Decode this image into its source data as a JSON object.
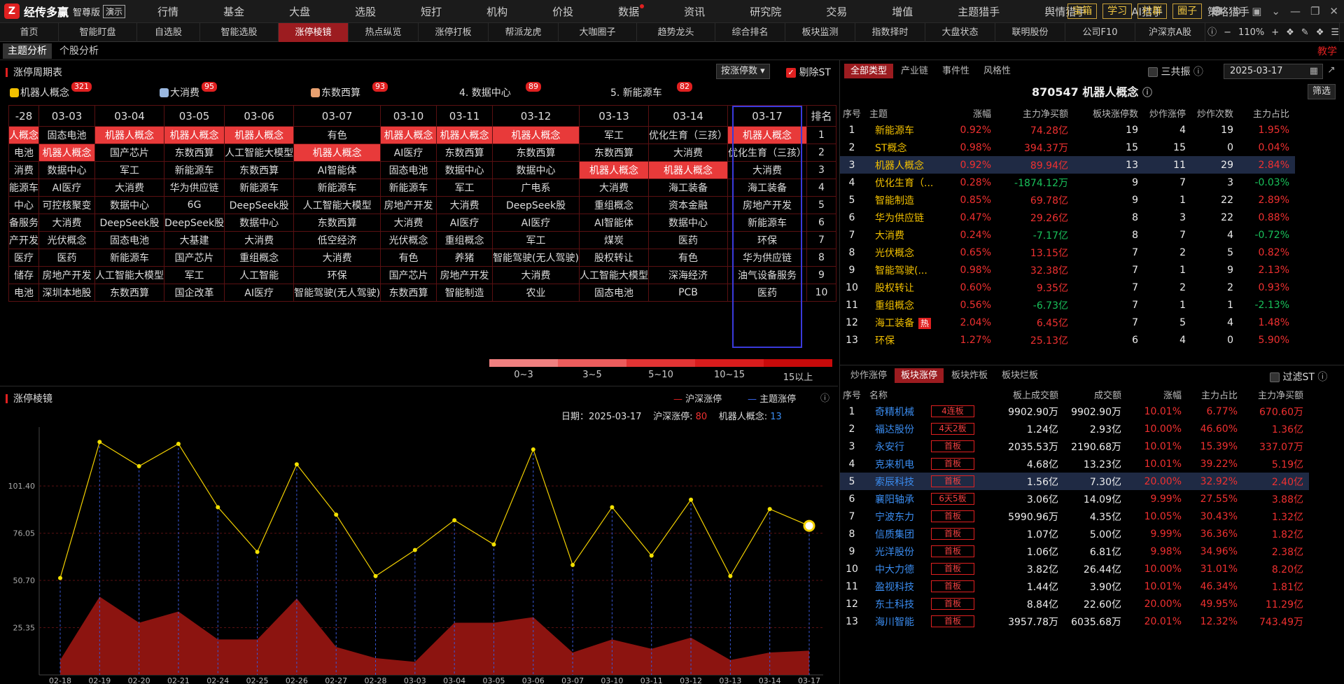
{
  "app": {
    "logo": "经传多赢",
    "edition": "智尊版",
    "demo": "演示"
  },
  "main_nav": [
    "行情",
    "基金",
    "大盘",
    "选股",
    "短打",
    "机构",
    "价投",
    "数据",
    "资讯",
    "研究院",
    "交易",
    "增值",
    "主题猎手",
    "舆情猎手",
    "AI猎手",
    "策略猎手"
  ],
  "top_right": {
    "buttons": [
      "宝箱",
      "学习",
      "社群",
      "圈子"
    ]
  },
  "sub_nav": [
    "首页",
    "智能盯盘",
    "自选股",
    "智能选股",
    "涨停棱镜",
    "热点纵览",
    "涨停打板",
    "帮派龙虎",
    "大咖圈子",
    "趋势龙头",
    "综合排名",
    "板块监测",
    "指数择时",
    "大盘状态",
    "联明股份",
    "公司F10",
    "沪深京A股"
  ],
  "sub_nav_active": "涨停棱镜",
  "zoom": "110%",
  "row3": {
    "tabs": [
      "主题分析",
      "个股分析"
    ],
    "teach": "教学"
  },
  "cycle": {
    "title": "涨停周期表",
    "sort_btn": "按涨停数",
    "exclude_st": "剔除ST",
    "top_themes": [
      {
        "name": "机器人概念",
        "badge": "321",
        "icon": "#f2c000"
      },
      {
        "name": "大消费",
        "badge": "95",
        "icon": "#9ab8e0"
      },
      {
        "name": "东数西算",
        "badge": "93",
        "icon": "#e8a070"
      },
      {
        "name": "4. 数据中心",
        "badge": "89"
      },
      {
        "name": "5. 新能源车",
        "badge": "82"
      }
    ],
    "dates": [
      "-28",
      "03-03",
      "03-04",
      "03-05",
      "03-06",
      "03-07",
      "03-10",
      "03-11",
      "03-12",
      "03-13",
      "03-14",
      "03-17"
    ],
    "rank_header": "排名",
    "rows": [
      [
        "人概念",
        "固态电池",
        "机器人概念",
        "机器人概念",
        "机器人概念",
        "有色",
        "机器人概念",
        "机器人概念",
        "机器人概念",
        "军工",
        "优化生育（三孩）",
        "机器人概念"
      ],
      [
        "电池",
        "机器人概念",
        "国产芯片",
        "东数西算",
        "人工智能大模型",
        "机器人概念",
        "AI医疗",
        "东数西算",
        "东数西算",
        "东数西算",
        "大消费",
        "优化生育（三孩）"
      ],
      [
        "消费",
        "数据中心",
        "军工",
        "新能源车",
        "东数西算",
        "AI智能体",
        "固态电池",
        "数据中心",
        "数据中心",
        "机器人概念",
        "机器人概念",
        "大消费"
      ],
      [
        "能源车",
        "AI医疗",
        "大消费",
        "华为供应链",
        "新能源车",
        "新能源车",
        "新能源车",
        "军工",
        "广电系",
        "大消费",
        "海工装备",
        "海工装备"
      ],
      [
        "中心",
        "可控核聚变",
        "数据中心",
        "6G",
        "DeepSeek股",
        "人工智能大模型",
        "房地产开发",
        "大消费",
        "DeepSeek股",
        "重组概念",
        "资本金融",
        "房地产开发"
      ],
      [
        "备服务",
        "大消费",
        "DeepSeek股",
        "DeepSeek股",
        "数据中心",
        "东数西算",
        "大消费",
        "AI医疗",
        "AI医疗",
        "AI智能体",
        "数据中心",
        "新能源车"
      ],
      [
        "产开发",
        "光伏概念",
        "固态电池",
        "大基建",
        "大消费",
        "低空经济",
        "光伏概念",
        "重组概念",
        "军工",
        "煤炭",
        "医药",
        "环保"
      ],
      [
        "医疗",
        "医药",
        "新能源车",
        "国产芯片",
        "重组概念",
        "大消费",
        "有色",
        "养猪",
        "智能驾驶(无人驾驶)",
        "股权转让",
        "有色",
        "华为供应链"
      ],
      [
        "储存",
        "房地产开发",
        "人工智能大模型",
        "军工",
        "人工智能",
        "环保",
        "国产芯片",
        "房地产开发",
        "大消费",
        "人工智能大模型",
        "深海经济",
        "油气设备服务"
      ],
      [
        "电池",
        "深圳本地股",
        "东数西算",
        "国企改革",
        "AI医疗",
        "智能驾驶(无人驾驶)",
        "东数西算",
        "智能制造",
        "农业",
        "固态电池",
        "PCB",
        "医药"
      ]
    ],
    "red_cells": [
      [
        0,
        0
      ],
      [
        0,
        2
      ],
      [
        0,
        3
      ],
      [
        0,
        4
      ],
      [
        0,
        6
      ],
      [
        0,
        7
      ],
      [
        0,
        8
      ],
      [
        0,
        11
      ],
      [
        1,
        1
      ],
      [
        1,
        5
      ],
      [
        2,
        9
      ],
      [
        2,
        10
      ]
    ],
    "ranks": [
      "1",
      "2",
      "3",
      "4",
      "5",
      "6",
      "7",
      "8",
      "9",
      "10"
    ],
    "legend": [
      {
        "label": "0~3",
        "color": "#f08080"
      },
      {
        "label": "3~5",
        "color": "#ec5c5c"
      },
      {
        "label": "5~10",
        "color": "#e23434"
      },
      {
        "label": "10~15",
        "color": "#d81c1c"
      },
      {
        "label": "15以上",
        "color": "#c80a0a"
      }
    ]
  },
  "prism": {
    "title": "涨停棱镜",
    "legend_a": "沪深涨停",
    "legend_b": "主题涨停",
    "info": {
      "date_label": "日期：",
      "date": "2025-03-17",
      "hs_label": "沪深涨停:",
      "hs_value": "80",
      "theme_label": "机器人概念:",
      "theme_value": "13"
    }
  },
  "chart_data": {
    "type": "line",
    "categories": [
      "02-18",
      "02-19",
      "02-20",
      "02-21",
      "02-24",
      "02-25",
      "02-26",
      "02-27",
      "02-28",
      "03-03",
      "03-04",
      "03-05",
      "03-06",
      "03-07",
      "03-10",
      "03-11",
      "03-12",
      "03-13",
      "03-14",
      "03-17"
    ],
    "series": [
      {
        "name": "沪深涨停",
        "values": [
          52,
          125,
          112,
          124,
          90,
          66,
          113,
          86,
          53,
          67,
          83,
          70,
          121,
          59,
          90,
          64,
          94,
          53,
          89,
          80
        ]
      },
      {
        "name": "主题涨停",
        "values": [
          8,
          42,
          28,
          34,
          19,
          19,
          41,
          15,
          9,
          7,
          28,
          28,
          31,
          12,
          19,
          14,
          20,
          8,
          12,
          13
        ]
      }
    ],
    "y_ticks": [
      "101.40",
      "76.05",
      "50.70",
      "25.35"
    ],
    "ylim": [
      0,
      133
    ]
  },
  "right_top": {
    "tabs": [
      "全部类型",
      "产业链",
      "事件性",
      "风格性"
    ],
    "sanngong": "三共振",
    "date": "2025-03-17",
    "title": "870547 机器人概念",
    "filter_btn": "筛选",
    "headers": [
      "序号",
      "主题",
      "涨幅",
      "主力净买额",
      "板块涨停数",
      "炒作涨停",
      "炒作次数",
      "主力占比"
    ],
    "rows": [
      [
        "1",
        "新能源车",
        "0.92%",
        "74.28亿",
        "19",
        "4",
        "19",
        "1.95%"
      ],
      [
        "2",
        "ST概念",
        "0.98%",
        "394.37万",
        "15",
        "15",
        "0",
        "0.04%"
      ],
      [
        "3",
        "机器人概念",
        "0.92%",
        "89.94亿",
        "13",
        "11",
        "29",
        "2.84%"
      ],
      [
        "4",
        "优化生育（...",
        "0.28%",
        "-1874.12万",
        "9",
        "7",
        "3",
        "-0.03%"
      ],
      [
        "5",
        "智能制造",
        "0.85%",
        "69.78亿",
        "9",
        "1",
        "22",
        "2.89%"
      ],
      [
        "6",
        "华为供应链",
        "0.47%",
        "29.26亿",
        "8",
        "3",
        "22",
        "0.88%"
      ],
      [
        "7",
        "大消费",
        "0.24%",
        "-7.17亿",
        "8",
        "7",
        "4",
        "-0.72%"
      ],
      [
        "8",
        "光伏概念",
        "0.65%",
        "13.15亿",
        "7",
        "2",
        "5",
        "0.82%"
      ],
      [
        "9",
        "智能驾驶(...",
        "0.98%",
        "32.38亿",
        "7",
        "1",
        "9",
        "2.13%"
      ],
      [
        "10",
        "股权转让",
        "0.60%",
        "9.35亿",
        "7",
        "2",
        "2",
        "0.93%"
      ],
      [
        "11",
        "重组概念",
        "0.56%",
        "-6.73亿",
        "7",
        "1",
        "1",
        "-2.13%"
      ],
      [
        "12",
        "海工装备",
        "2.04%",
        "6.45亿",
        "7",
        "5",
        "4",
        "1.48%"
      ],
      [
        "13",
        "环保",
        "1.27%",
        "25.13亿",
        "6",
        "4",
        "0",
        "5.90%"
      ]
    ],
    "hot_label": "热"
  },
  "right_bottom": {
    "tabs": [
      "炒作涨停",
      "板块涨停",
      "板块炸板",
      "板块烂板"
    ],
    "active": "板块涨停",
    "filter_st": "过滤ST",
    "headers": [
      "序号",
      "名称",
      "",
      "板上成交额",
      "成交额",
      "涨幅",
      "主力占比",
      "主力净买额"
    ],
    "rows": [
      [
        "1",
        "奇精机械",
        "4连板",
        "9902.90万",
        "9902.90万",
        "10.01%",
        "6.77%",
        "670.60万"
      ],
      [
        "2",
        "福达股份",
        "4天2板",
        "1.24亿",
        "2.93亿",
        "10.00%",
        "46.60%",
        "1.36亿"
      ],
      [
        "3",
        "永安行",
        "首板",
        "2035.53万",
        "2190.68万",
        "10.01%",
        "15.39%",
        "337.07万"
      ],
      [
        "4",
        "克来机电",
        "首板",
        "4.68亿",
        "13.23亿",
        "10.01%",
        "39.22%",
        "5.19亿"
      ],
      [
        "5",
        "索辰科技",
        "首板",
        "1.56亿",
        "7.30亿",
        "20.00%",
        "32.92%",
        "2.40亿"
      ],
      [
        "6",
        "襄阳轴承",
        "6天5板",
        "3.06亿",
        "14.09亿",
        "9.99%",
        "27.55%",
        "3.88亿"
      ],
      [
        "7",
        "宁波东力",
        "首板",
        "5990.96万",
        "4.35亿",
        "10.05%",
        "30.43%",
        "1.32亿"
      ],
      [
        "8",
        "信质集团",
        "首板",
        "1.07亿",
        "5.00亿",
        "9.99%",
        "36.36%",
        "1.82亿"
      ],
      [
        "9",
        "光洋股份",
        "首板",
        "1.06亿",
        "6.81亿",
        "9.98%",
        "34.96%",
        "2.38亿"
      ],
      [
        "10",
        "中大力德",
        "首板",
        "3.82亿",
        "26.44亿",
        "10.00%",
        "31.01%",
        "8.20亿"
      ],
      [
        "11",
        "盈视科技",
        "首板",
        "1.44亿",
        "3.90亿",
        "10.01%",
        "46.34%",
        "1.81亿"
      ],
      [
        "12",
        "东土科技",
        "首板",
        "8.84亿",
        "22.60亿",
        "20.00%",
        "49.95%",
        "11.29亿"
      ],
      [
        "13",
        "海川智能",
        "首板",
        "3957.78万",
        "6035.68万",
        "20.01%",
        "12.32%",
        "743.49万"
      ]
    ]
  }
}
